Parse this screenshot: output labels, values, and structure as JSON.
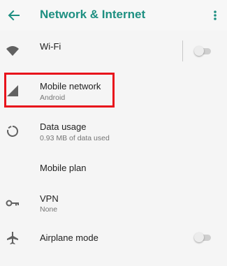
{
  "header": {
    "title": "Network & Internet",
    "back_icon": "arrow-left-icon",
    "menu_icon": "more-vertical-icon"
  },
  "items": [
    {
      "label": "Wi-Fi",
      "icon": "wifi-icon",
      "toggle": "off"
    },
    {
      "label": "Mobile network",
      "sublabel": "Android",
      "icon": "signal-icon"
    },
    {
      "label": "Data usage",
      "sublabel": "0.93 MB of data used",
      "icon": "data-usage-icon"
    },
    {
      "label": "Mobile plan"
    },
    {
      "label": "VPN",
      "sublabel": "None",
      "icon": "key-icon"
    },
    {
      "label": "Airplane mode",
      "icon": "airplane-icon",
      "toggle": "off"
    }
  ],
  "colors": {
    "accent": "#1d8f81",
    "highlight": "#e8141c",
    "icon": "#616161",
    "background": "#f5f5f5"
  }
}
